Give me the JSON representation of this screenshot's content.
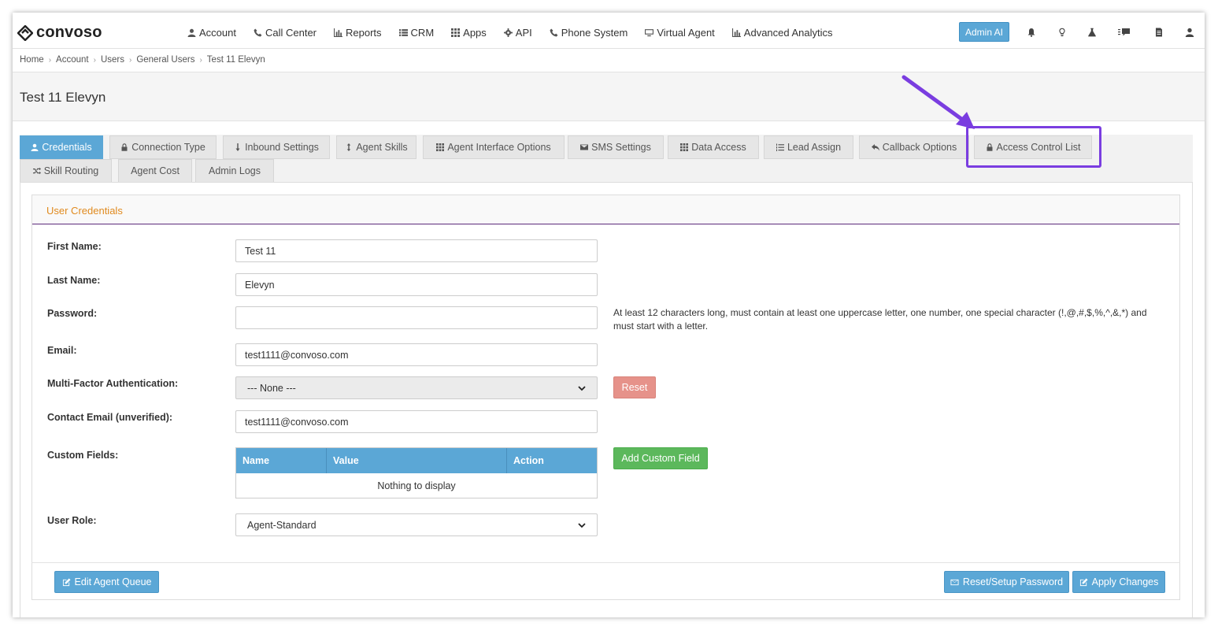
{
  "brand": {
    "name": "convoso"
  },
  "nav": {
    "items": [
      {
        "label": "Account",
        "icon": "user-icon"
      },
      {
        "label": "Call Center",
        "icon": "phone-icon"
      },
      {
        "label": "Reports",
        "icon": "bar-chart-icon"
      },
      {
        "label": "CRM",
        "icon": "list-icon"
      },
      {
        "label": "Apps",
        "icon": "grid-icon"
      },
      {
        "label": "API",
        "icon": "gear-icon"
      },
      {
        "label": "Phone System",
        "icon": "phone-icon"
      },
      {
        "label": "Virtual Agent",
        "icon": "monitor-icon"
      },
      {
        "label": "Advanced Analytics",
        "icon": "bar-chart-icon"
      }
    ],
    "admin_ai": "Admin AI",
    "right_icons": [
      "bell-icon",
      "lightbulb-icon",
      "flask-icon",
      "feedback-icon",
      "document-icon",
      "user-icon"
    ]
  },
  "breadcrumb": [
    "Home",
    "Account",
    "Users",
    "General Users",
    "Test 11 Elevyn"
  ],
  "page": {
    "title": "Test 11 Elevyn"
  },
  "tabs": [
    {
      "label": "Credentials",
      "icon": "user-icon",
      "active": true
    },
    {
      "label": "Connection Type",
      "icon": "lock-icon"
    },
    {
      "label": "Inbound Settings",
      "icon": "arrow-down-icon"
    },
    {
      "label": "Agent Skills",
      "icon": "arrows-vertical-icon"
    },
    {
      "label": "Agent Interface Options",
      "icon": "grid-icon"
    },
    {
      "label": "SMS Settings",
      "icon": "envelope-icon"
    },
    {
      "label": "Data Access",
      "icon": "grid-icon"
    },
    {
      "label": "Lead Assign",
      "icon": "ordered-list-icon"
    },
    {
      "label": "Callback Options",
      "icon": "reply-icon"
    },
    {
      "label": "Access Control List",
      "icon": "lock-icon"
    },
    {
      "label": "Skill Routing",
      "icon": "shuffle-icon"
    },
    {
      "label": "Agent Cost",
      "icon": ""
    },
    {
      "label": "Admin Logs",
      "icon": ""
    }
  ],
  "panel": {
    "title": "User Credentials",
    "fields": {
      "first_name": {
        "label": "First Name:",
        "value": "Test 11"
      },
      "last_name": {
        "label": "Last Name:",
        "value": "Elevyn"
      },
      "password": {
        "label": "Password:",
        "value": ""
      },
      "email": {
        "label": "Email:",
        "value": "test1111@convoso.com"
      },
      "mfa": {
        "label": "Multi-Factor Authentication:",
        "value": "--- None ---"
      },
      "contact_email": {
        "label": "Contact Email (unverified):",
        "value": "test1111@convoso.com"
      },
      "custom_fields": {
        "label": "Custom Fields:"
      },
      "user_role": {
        "label": "User Role:",
        "value": "Agent-Standard"
      }
    },
    "password_hint": "At least 12 characters long, must contain at least one uppercase letter, one number, one special character (!,@,#,$,%,^,&,*) and must start with a letter.",
    "reset_label": "Reset",
    "custom_table": {
      "columns": [
        "Name",
        "Value",
        "Action"
      ],
      "empty": "Nothing to display"
    },
    "add_custom_label": "Add Custom Field"
  },
  "footer": {
    "edit_queue": "Edit Agent Queue",
    "reset_password": "Reset/Setup Password",
    "apply": "Apply Changes"
  },
  "colors": {
    "primary": "#5ba7d6",
    "success": "#5cb85c",
    "danger_light": "#e6928a",
    "panel_title": "#e08a1e",
    "highlight": "#7a3de0"
  }
}
